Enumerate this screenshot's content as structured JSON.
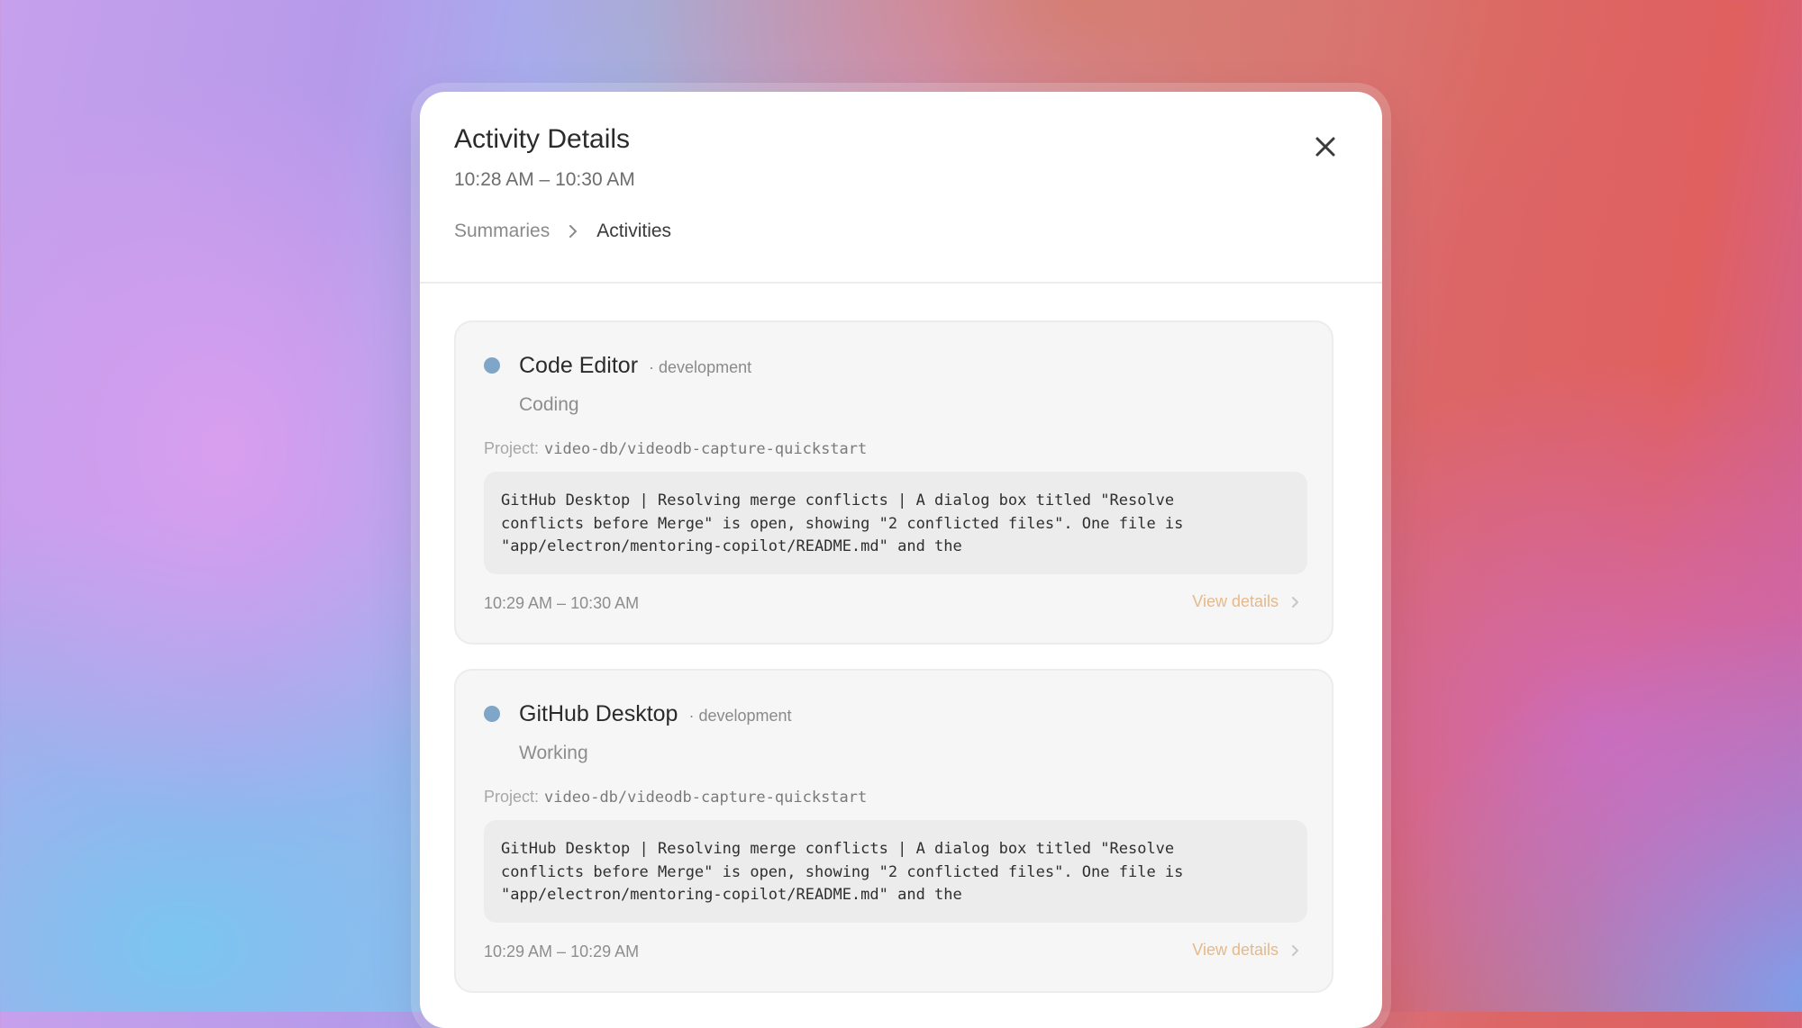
{
  "modal": {
    "title": "Activity Details",
    "time_range": "10:28 AM – 10:30 AM",
    "breadcrumb": [
      "Summaries",
      "Activities"
    ]
  },
  "activities": [
    {
      "app": "Code Editor",
      "category": "· development",
      "activity": "Coding",
      "project_label": "Project:",
      "project": "video-db/videodb-capture-quickstart",
      "description": "GitHub Desktop | Resolving merge conflicts | A dialog box titled \"Resolve\nconflicts before Merge\" is open, showing \"2 conflicted files\". One file is\n\"app/electron/mentoring-copilot/README.md\" and the",
      "time": "10:29 AM – 10:30 AM",
      "view_details": "View details"
    },
    {
      "app": "GitHub Desktop",
      "category": "· development",
      "activity": "Working",
      "project_label": "Project:",
      "project": "video-db/videodb-capture-quickstart",
      "description": "GitHub Desktop | Resolving merge conflicts | A dialog box titled \"Resolve\nconflicts before Merge\" is open, showing \"2 conflicted files\". One file is\n\"app/electron/mentoring-copilot/README.md\" and the",
      "time": "10:29 AM – 10:29 AM",
      "view_details": "View details"
    }
  ],
  "colors": {
    "status_dot": "#7fa6c7",
    "accent_link": "#e5b98a"
  },
  "icons": {
    "close": "close-icon",
    "breadcrumb_separator": "chevron-right-icon",
    "view_details": "chevron-right-icon"
  }
}
